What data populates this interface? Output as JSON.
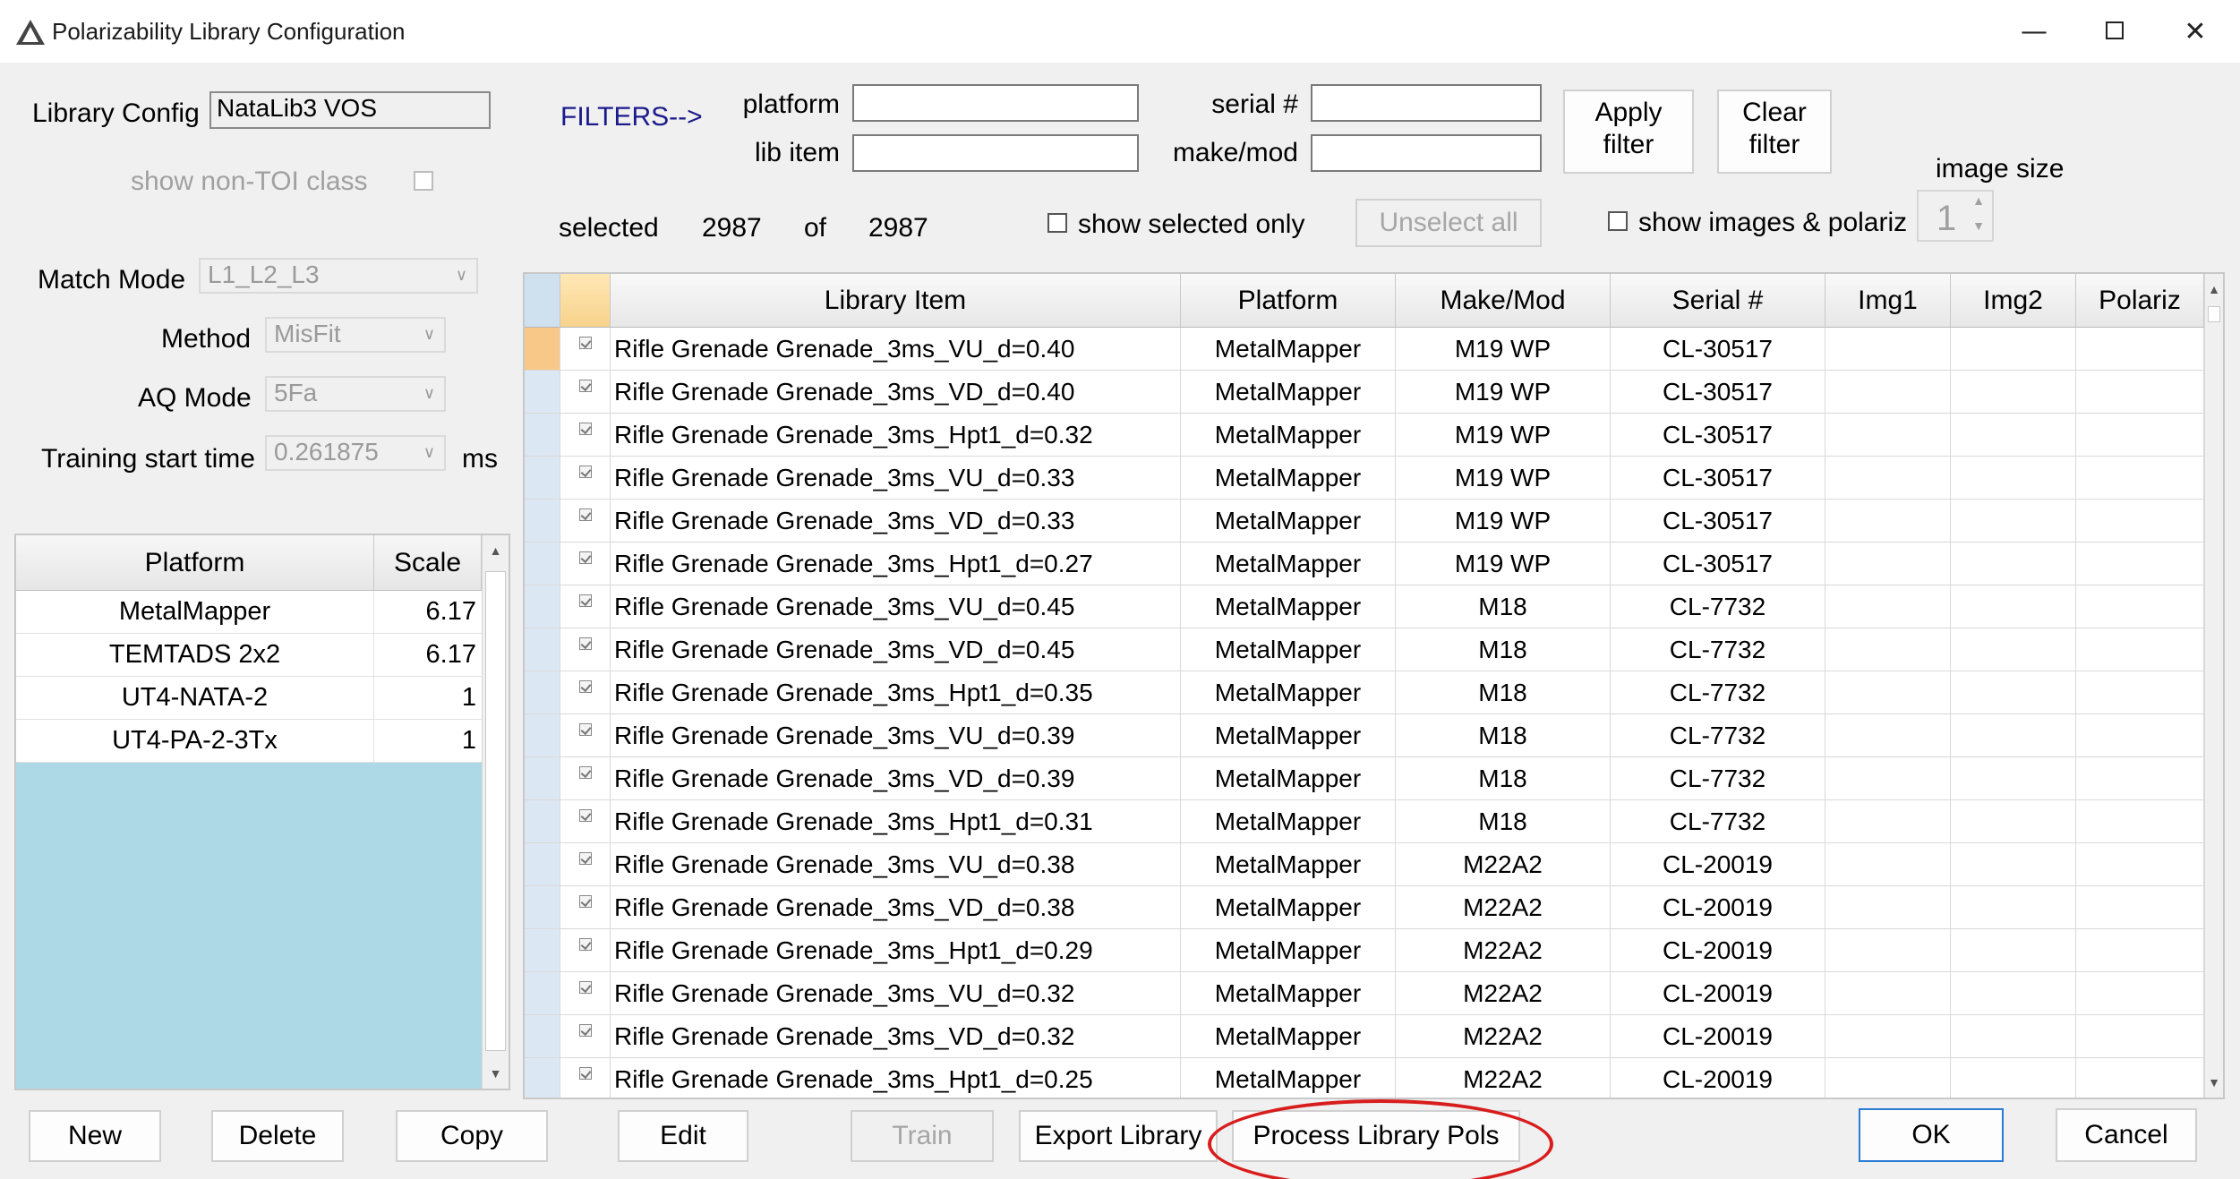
{
  "window": {
    "title": "Polarizability Library Configuration",
    "minimize_glyph": "—",
    "close_glyph": "✕"
  },
  "config": {
    "library_config_label": "Library Config",
    "library_config_value": "NataLib3 VOS",
    "show_non_toi_label": "show non-TOI class",
    "match_mode_label": "Match Mode",
    "match_mode_value": "L1_L2_L3",
    "method_label": "Method",
    "method_value": "MisFit",
    "aq_mode_label": "AQ Mode",
    "aq_mode_value": "5Fa",
    "training_start_label": "Training start time",
    "training_start_value": "0.261875",
    "training_start_unit": "ms"
  },
  "filters": {
    "title": "FILTERS-->",
    "platform_label": "platform",
    "platform_value": "",
    "lib_item_label": "lib item",
    "lib_item_value": "",
    "serial_label": "serial #",
    "serial_value": "",
    "make_mod_label": "make/mod",
    "make_mod_value": "",
    "apply_line1": "Apply",
    "apply_line2": "filter",
    "clear_line1": "Clear",
    "clear_line2": "filter",
    "image_size_label": "image size",
    "image_size_value": "1"
  },
  "selection": {
    "selected_label": "selected",
    "selected_count": "2987",
    "of_label": "of",
    "total_count": "2987",
    "show_selected_only_label": "show selected only",
    "unselect_all_label": "Unselect all",
    "show_images_label": "show images & polariz"
  },
  "platform_table": {
    "headers": [
      "Platform",
      "Scale"
    ],
    "rows": [
      {
        "platform": "MetalMapper",
        "scale": "6.17"
      },
      {
        "platform": "TEMTADS 2x2",
        "scale": "6.17"
      },
      {
        "platform": "UT4-NATA-2",
        "scale": "1"
      },
      {
        "platform": "UT4-PA-2-3Tx",
        "scale": "1"
      }
    ]
  },
  "library_table": {
    "headers": [
      "Library Item",
      "Platform",
      "Make/Mod",
      "Serial #",
      "Img1",
      "Img2",
      "Polariz"
    ],
    "rows": [
      {
        "item": "Rifle Grenade Grenade_3ms_VU_d=0.40",
        "platform": "MetalMapper",
        "make": "M19 WP",
        "serial": "CL-30517"
      },
      {
        "item": "Rifle Grenade Grenade_3ms_VD_d=0.40",
        "platform": "MetalMapper",
        "make": "M19 WP",
        "serial": "CL-30517"
      },
      {
        "item": "Rifle Grenade Grenade_3ms_Hpt1_d=0.32",
        "platform": "MetalMapper",
        "make": "M19 WP",
        "serial": "CL-30517"
      },
      {
        "item": "Rifle Grenade Grenade_3ms_VU_d=0.33",
        "platform": "MetalMapper",
        "make": "M19 WP",
        "serial": "CL-30517"
      },
      {
        "item": "Rifle Grenade Grenade_3ms_VD_d=0.33",
        "platform": "MetalMapper",
        "make": "M19 WP",
        "serial": "CL-30517"
      },
      {
        "item": "Rifle Grenade Grenade_3ms_Hpt1_d=0.27",
        "platform": "MetalMapper",
        "make": "M19 WP",
        "serial": "CL-30517"
      },
      {
        "item": "Rifle Grenade Grenade_3ms_VU_d=0.45",
        "platform": "MetalMapper",
        "make": "M18",
        "serial": "CL-7732"
      },
      {
        "item": "Rifle Grenade Grenade_3ms_VD_d=0.45",
        "platform": "MetalMapper",
        "make": "M18",
        "serial": "CL-7732"
      },
      {
        "item": "Rifle Grenade Grenade_3ms_Hpt1_d=0.35",
        "platform": "MetalMapper",
        "make": "M18",
        "serial": "CL-7732"
      },
      {
        "item": "Rifle Grenade Grenade_3ms_VU_d=0.39",
        "platform": "MetalMapper",
        "make": "M18",
        "serial": "CL-7732"
      },
      {
        "item": "Rifle Grenade Grenade_3ms_VD_d=0.39",
        "platform": "MetalMapper",
        "make": "M18",
        "serial": "CL-7732"
      },
      {
        "item": "Rifle Grenade Grenade_3ms_Hpt1_d=0.31",
        "platform": "MetalMapper",
        "make": "M18",
        "serial": "CL-7732"
      },
      {
        "item": "Rifle Grenade Grenade_3ms_VU_d=0.38",
        "platform": "MetalMapper",
        "make": "M22A2",
        "serial": "CL-20019"
      },
      {
        "item": "Rifle Grenade Grenade_3ms_VD_d=0.38",
        "platform": "MetalMapper",
        "make": "M22A2",
        "serial": "CL-20019"
      },
      {
        "item": "Rifle Grenade Grenade_3ms_Hpt1_d=0.29",
        "platform": "MetalMapper",
        "make": "M22A2",
        "serial": "CL-20019"
      },
      {
        "item": "Rifle Grenade Grenade_3ms_VU_d=0.32",
        "platform": "MetalMapper",
        "make": "M22A2",
        "serial": "CL-20019"
      },
      {
        "item": "Rifle Grenade Grenade_3ms_VD_d=0.32",
        "platform": "MetalMapper",
        "make": "M22A2",
        "serial": "CL-20019"
      },
      {
        "item": "Rifle Grenade Grenade_3ms_Hpt1_d=0.25",
        "platform": "MetalMapper",
        "make": "M22A2",
        "serial": "CL-20019"
      }
    ]
  },
  "buttons": {
    "new": "New",
    "delete": "Delete",
    "copy": "Copy",
    "edit": "Edit",
    "train": "Train",
    "export_library": "Export Library",
    "process_library_pols": "Process Library Pols",
    "ok": "OK",
    "cancel": "Cancel"
  },
  "colors": {
    "annotation": "#d81d1d",
    "platform_table_bg": "#add8e6",
    "filters_label": "#1a1a8c",
    "active_row_header": "#f8c889"
  }
}
